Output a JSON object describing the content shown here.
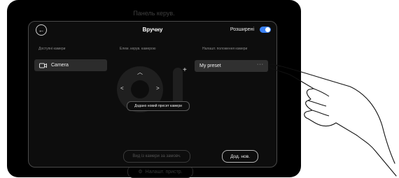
{
  "background_title": "Панель керув.",
  "header": {
    "title": "Вручну",
    "advanced_label": "Розширені",
    "advanced_enabled": true,
    "accent_color": "#3b82f6"
  },
  "columns": {
    "available_cameras": "Доступні камери",
    "camera_control": "Елем. керув. камерою",
    "saved_presets": "Налашт. положення камери"
  },
  "cameras": [
    {
      "label": "Camera",
      "icon": "camera-icon"
    }
  ],
  "presets": [
    {
      "label": "My preset",
      "menu": "···"
    }
  ],
  "toast": "Додано новий пресет камери",
  "buttons": {
    "view_from_camera": "Вид із камери за замовч.",
    "add_new": "Дод. нов."
  },
  "background_settings": "Налашт. пристр."
}
